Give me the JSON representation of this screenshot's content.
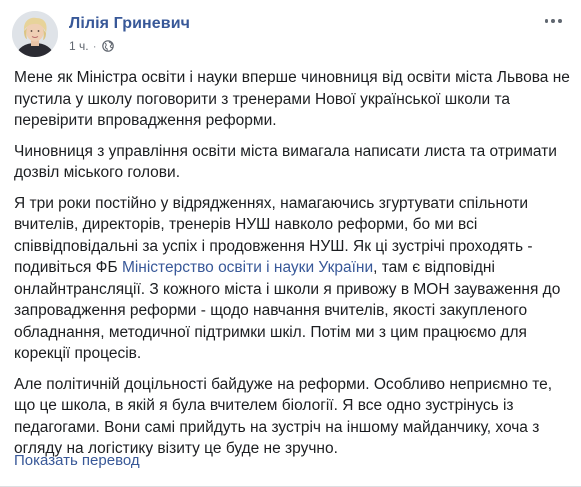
{
  "post": {
    "author": "Лілія Гриневич",
    "time": "1 ч.",
    "separator": "·",
    "privacy_icon": "globe-icon",
    "more_icon": "more-options-icon",
    "paragraphs": {
      "p1": "Мене як Міністра освіти і науки вперше чиновниця від освіти міста Львова не пустила у школу поговорити з тренерами Нової української школи та перевірити впровадження реформи.",
      "p2": "Чиновниця з управління освіти міста вимагала написати листа та отримати дозвіл міського голови.",
      "p3_before": "Я три роки постійно у відрядженнях, намагаючись згуртувати спільноти вчителів, директорів, тренерів НУШ навколо реформи, бо ми всі співвідповідальні за успіх і продовження НУШ. Як ці зустрічі проходять - подивіться ФБ ",
      "p3_link": "Міністерство освіти і науки України",
      "p3_after": ", там є відповідні онлайнтрансляції. З кожного міста і школи я привожу в МОН зауваження до запровадження реформи - щодо навчання вчителів, якості закупленого обладнання, методичної підтримки шкіл. Потім ми з цим працюємо для корекції процесів.",
      "p4": "Але політичній доцільності байдуже на реформи. Особливо неприємно те, що це школа, в якій я була вчителем біології. Я все одно зустрінусь із педагогами. Вони самі прийдуть на зустріч на іншому майданчику, хоча з огляду на логістику візиту це буде не зручно."
    },
    "translate_label": "Показать перевод"
  },
  "colors": {
    "link": "#385898",
    "text": "#1c1e21",
    "meta": "#616770"
  }
}
